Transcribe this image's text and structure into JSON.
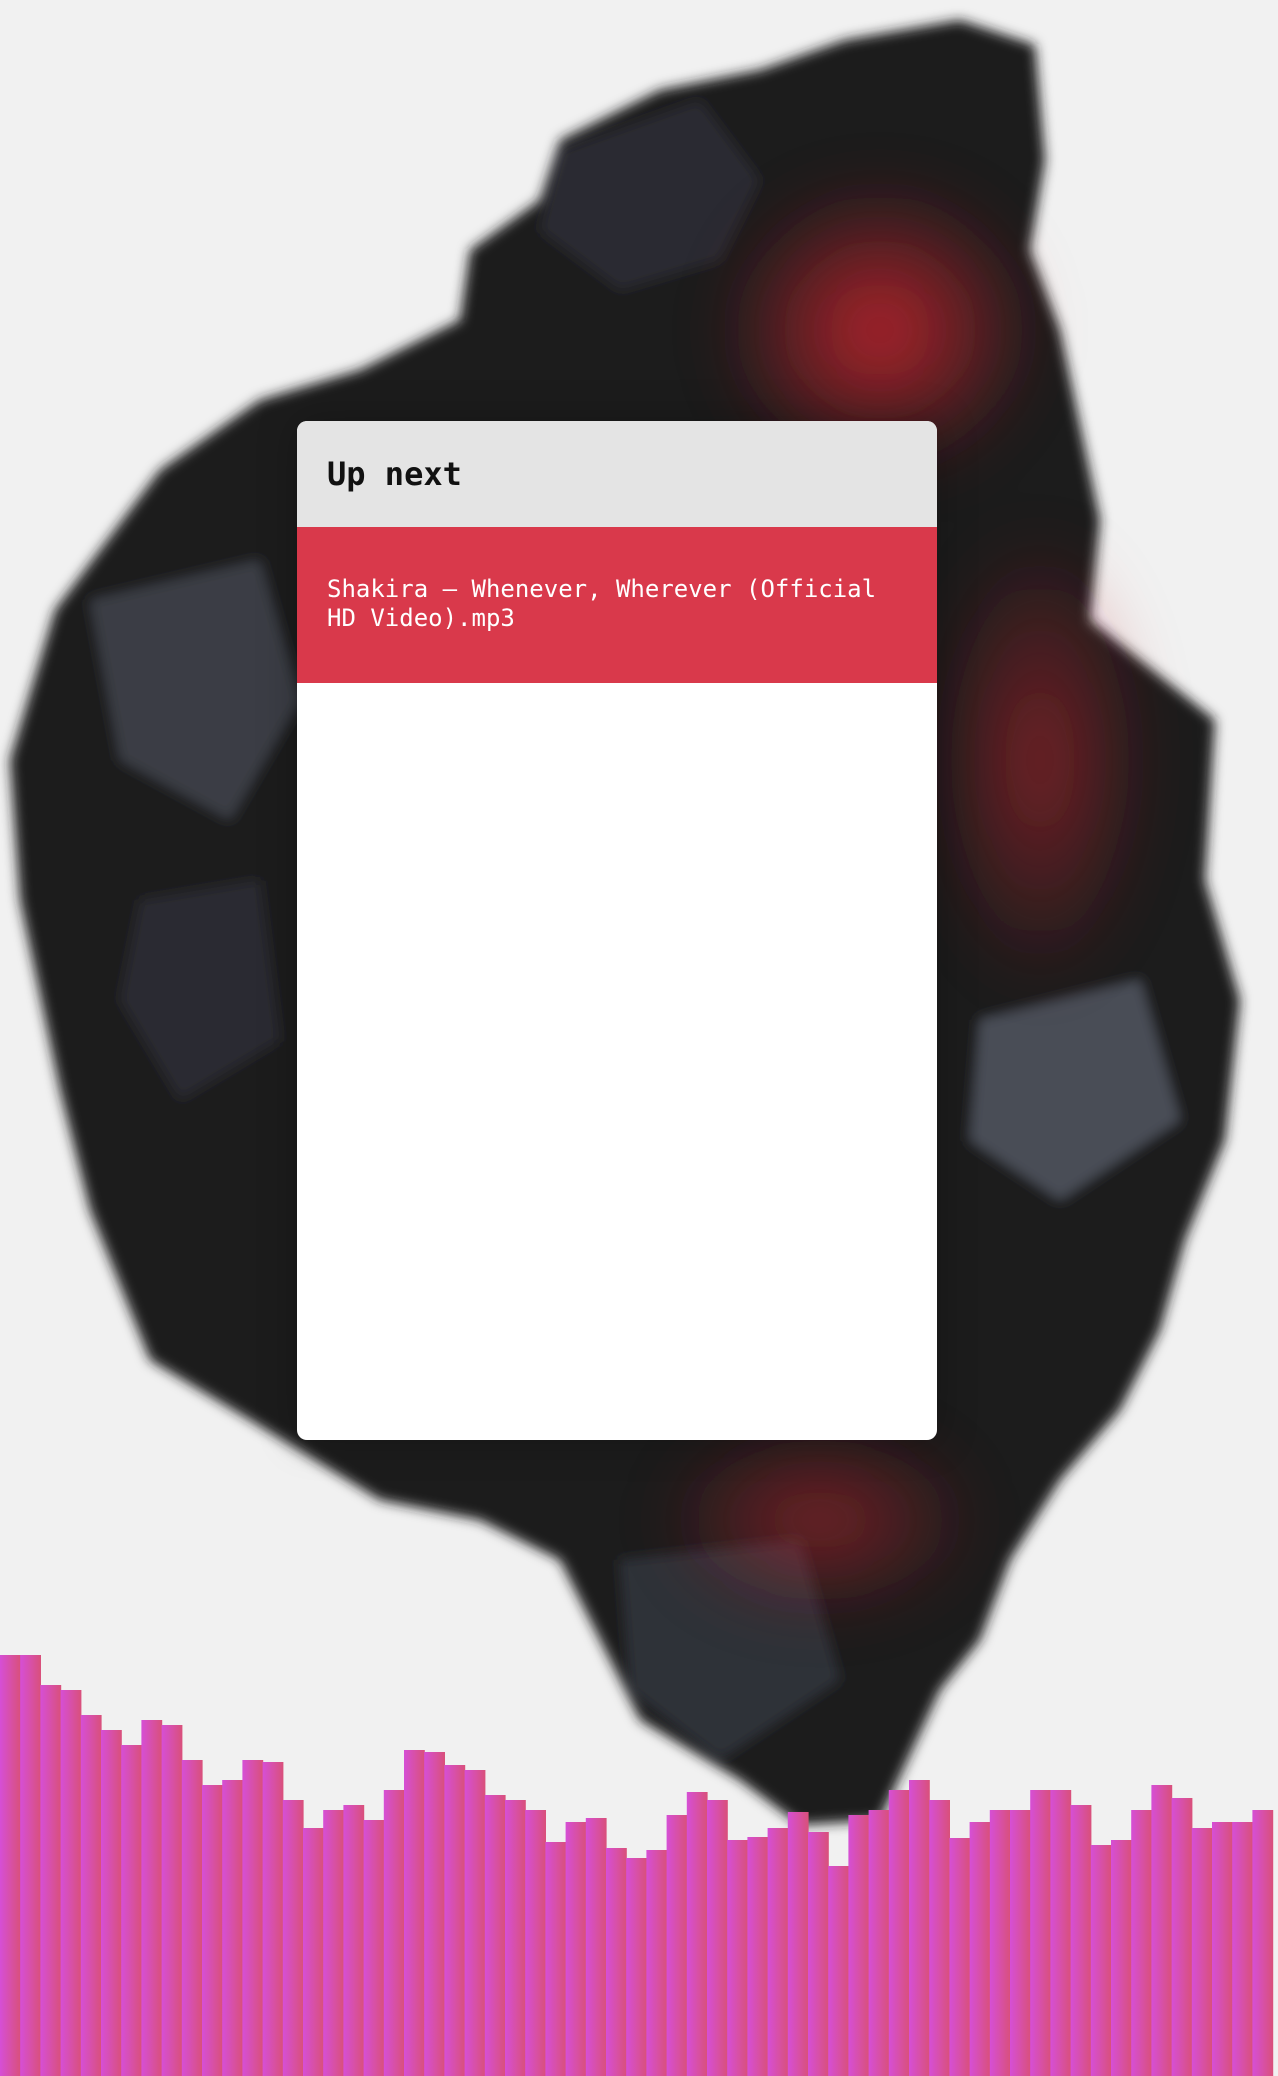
{
  "panel": {
    "title": "Up next",
    "queue": [
      {
        "label": "Shakira – Whenever, Wherever (Official HD Video).mp3",
        "active": true
      }
    ]
  },
  "colors": {
    "active_item": "#d9394b",
    "header_bg": "#e4e4e4",
    "visualizer_start": "#d64fd6",
    "visualizer_end": "#d9507a"
  },
  "icons": [
    "album-art-background",
    "audio-visualizer"
  ]
}
